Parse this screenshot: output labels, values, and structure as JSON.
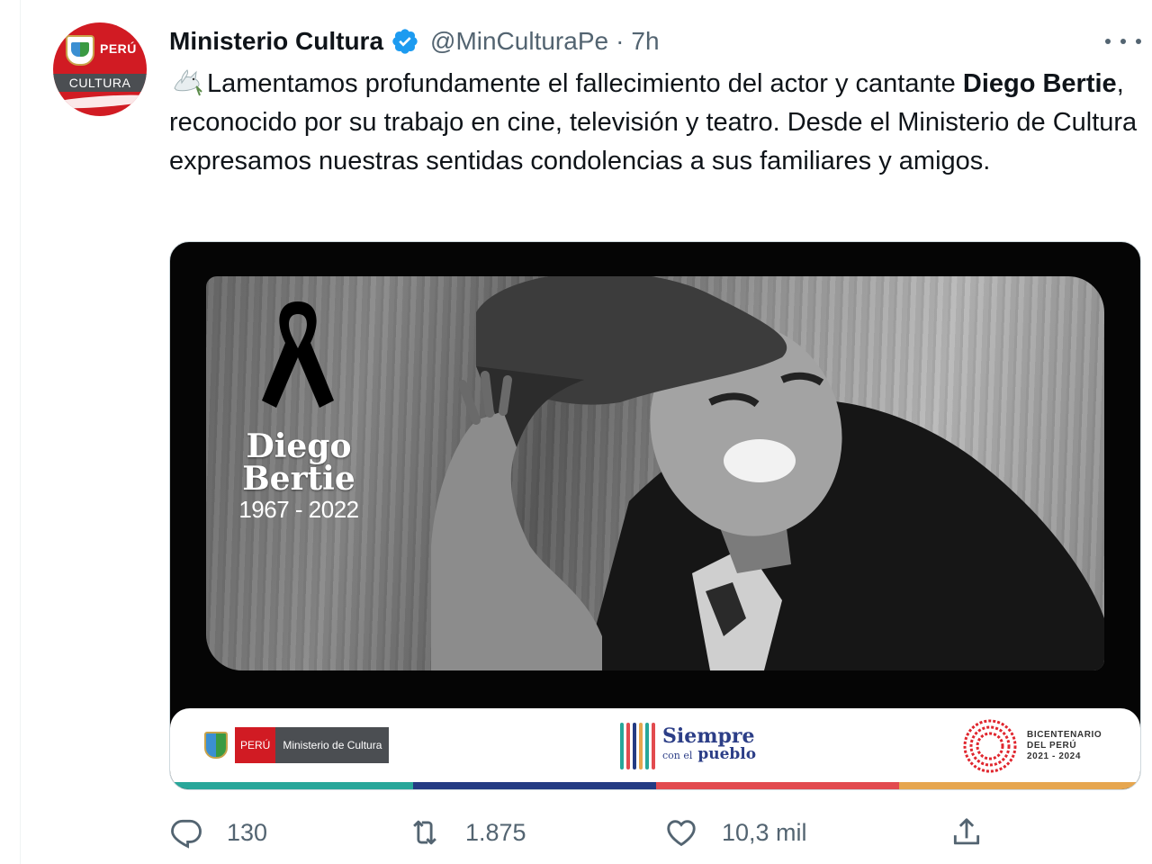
{
  "account": {
    "display_name": "Ministerio Cultura",
    "handle": "@MinCulturaPe",
    "separator": "·",
    "time": "7h",
    "avatar_top": "PERÚ",
    "avatar_bottom": "CULTURA"
  },
  "tweet": {
    "text_intro": "Lamentamos profundamente el fallecimiento del actor y cantante ",
    "text_bold": "Diego Bertie",
    "text_rest": ", reconocido por su trabajo en cine, televisión y teatro. Desde el Ministerio de Cultura expresamos nuestras sentidas condolencias a sus familiares y amigos.",
    "emoji_icon": "dove-icon"
  },
  "media": {
    "name_first": "Diego",
    "name_last": "Bertie",
    "years": "1967 - 2022",
    "logo_peru": "PERÚ",
    "logo_ministry": "Ministerio de Cultura",
    "slogan_main": "Siempre",
    "slogan_sub_small": "con el",
    "slogan_sub": "pueblo",
    "bicentenario_line1": "BICENTENARIO",
    "bicentenario_line2": "DEL PERÚ",
    "bicentenario_line3": "2021 - 2024",
    "stripe_colors": [
      "#28a79a",
      "#243b83",
      "#e24b4f",
      "#e6a64f"
    ]
  },
  "actions": {
    "replies": "130",
    "retweets": "1.875",
    "likes": "10,3 mil"
  },
  "colors": {
    "verified": "#1d9bf0",
    "secondary_text": "#536471",
    "brand_red": "#d11b23"
  }
}
